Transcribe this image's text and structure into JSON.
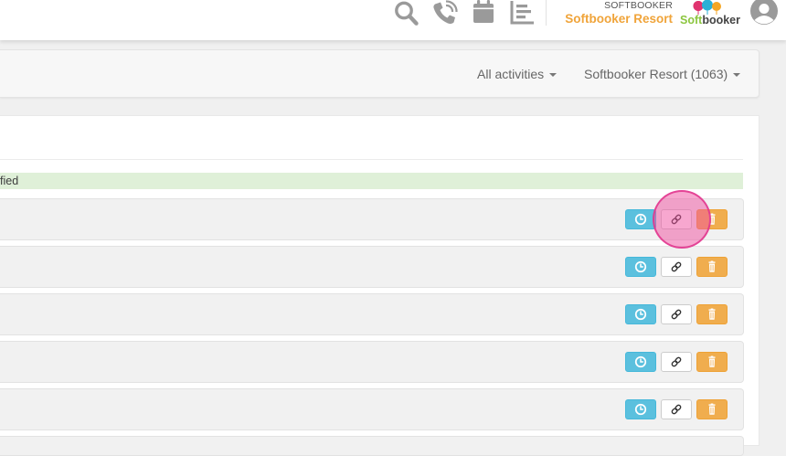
{
  "header": {
    "brand_small": "SOFTBOOKER",
    "brand_big": "Softbooker Resort",
    "logo": {
      "text_part1": "Soft",
      "text_part2": "booker"
    },
    "icons": [
      "search-icon",
      "phone-icon",
      "calendar-icon",
      "report-icon",
      "user-avatar-icon"
    ]
  },
  "subnav": {
    "activities_label": "All activities",
    "resort_label": "Softbooker Resort (1063)"
  },
  "panel": {
    "success_message": "fied"
  },
  "rows": [
    {
      "actions": [
        "clock-icon",
        "link-icon",
        "trash-icon"
      ]
    },
    {
      "actions": [
        "clock-icon",
        "link-icon",
        "trash-icon"
      ]
    },
    {
      "actions": [
        "clock-icon",
        "link-icon",
        "trash-icon"
      ]
    },
    {
      "actions": [
        "clock-icon",
        "link-icon",
        "trash-icon"
      ]
    },
    {
      "actions": [
        "clock-icon",
        "link-icon",
        "trash-icon"
      ]
    }
  ],
  "colors": {
    "brand_orange": "#f0a43a",
    "logo_green": "#8cc63f",
    "info_button": "#5bc0de",
    "warning_button": "#f0ad4e",
    "success_bg": "#dff0d8",
    "click_highlight": "#ef4f9f"
  }
}
